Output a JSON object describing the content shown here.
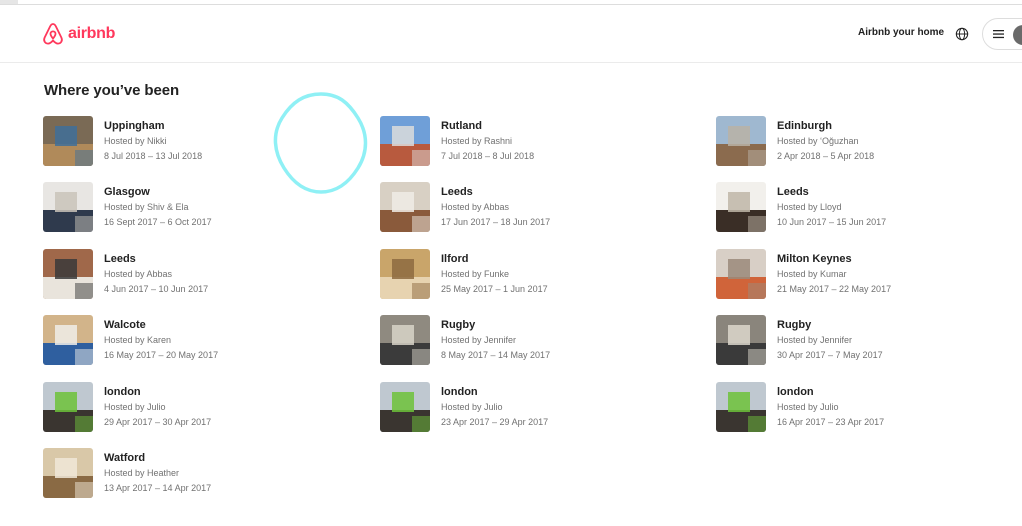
{
  "brand": {
    "name": "airbnb",
    "color": "#FF385C"
  },
  "header": {
    "host_link": "Airbnb your home",
    "globe_icon": "globe-icon",
    "menu_icon": "hamburger-menu-icon",
    "avatar_icon": "user-avatar-icon"
  },
  "page": {
    "title": "Where you’ve been"
  },
  "trips": [
    {
      "place": "Uppingham",
      "host": "Hosted by Nikki",
      "dates": "8 Jul 2018 – 13 Jul 2018",
      "thumb_colors": [
        "#7a6a55",
        "#b08a5a",
        "#3f6f9a"
      ]
    },
    {
      "place": "Rutland",
      "host": "Hosted by Rashni",
      "dates": "7 Jul 2018 – 8 Jul 2018",
      "thumb_colors": [
        "#6f9fd8",
        "#b85a3e",
        "#dcdcdc"
      ]
    },
    {
      "place": "Edinburgh",
      "host": "Hosted by ‘Oğuzhan",
      "dates": "2 Apr 2018 – 5 Apr 2018",
      "thumb_colors": [
        "#9fb8d0",
        "#8b6b4e",
        "#b9b2a6"
      ]
    },
    {
      "place": "Glasgow",
      "host": "Hosted by Shiv & Ela",
      "dates": "16 Sept 2017 – 6 Oct 2017",
      "thumb_colors": [
        "#e8e6e3",
        "#2f3a4d",
        "#c9c3ba"
      ]
    },
    {
      "place": "Leeds",
      "host": "Hosted by Abbas",
      "dates": "17 Jun 2017 – 18 Jun 2017",
      "thumb_colors": [
        "#d8d0c4",
        "#8a5a3b",
        "#f0ece6"
      ]
    },
    {
      "place": "Leeds",
      "host": "Hosted by Lloyd",
      "dates": "10 Jun 2017 – 15 Jun 2017",
      "thumb_colors": [
        "#f2f0ec",
        "#3a2e26",
        "#c0b6a8"
      ]
    },
    {
      "place": "Leeds",
      "host": "Hosted by Abbas",
      "dates": "4 Jun 2017 – 10 Jun 2017",
      "thumb_colors": [
        "#a0684a",
        "#e9e4dc",
        "#3a3a3a"
      ]
    },
    {
      "place": "Ilford",
      "host": "Hosted by Funke",
      "dates": "25 May 2017 – 1 Jun 2017",
      "thumb_colors": [
        "#c9a56a",
        "#e7d3b0",
        "#8d6a3f"
      ]
    },
    {
      "place": "Milton Keynes",
      "host": "Hosted by Kumar",
      "dates": "21 May 2017 – 22 May 2017",
      "thumb_colors": [
        "#d8cfc6",
        "#d0643a",
        "#9b8a7a"
      ]
    },
    {
      "place": "Walcote",
      "host": "Hosted by Karen",
      "dates": "16 May 2017 – 20 May 2017",
      "thumb_colors": [
        "#d2b48a",
        "#2f5f9f",
        "#f0ede8"
      ]
    },
    {
      "place": "Rugby",
      "host": "Hosted by Jennifer",
      "dates": "8 May 2017 – 14 May 2017",
      "thumb_colors": [
        "#8f8a80",
        "#3b3b3b",
        "#d8d3c8"
      ]
    },
    {
      "place": "Rugby",
      "host": "Hosted by Jennifer",
      "dates": "30 Apr 2017 – 7 May 2017",
      "thumb_colors": [
        "#8a857c",
        "#3a3a3a",
        "#dcd7cc"
      ]
    },
    {
      "place": "london",
      "host": "Hosted by Julio",
      "dates": "29 Apr 2017 – 30 Apr 2017",
      "thumb_colors": [
        "#bfc8d0",
        "#3a3530",
        "#6dc23a"
      ]
    },
    {
      "place": "london",
      "host": "Hosted by Julio",
      "dates": "23 Apr 2017 – 29 Apr 2017",
      "thumb_colors": [
        "#bfc8d0",
        "#3a3530",
        "#6dc23a"
      ]
    },
    {
      "place": "london",
      "host": "Hosted by Julio",
      "dates": "16 Apr 2017 – 23 Apr 2017",
      "thumb_colors": [
        "#bfc8d0",
        "#3a3530",
        "#6dc23a"
      ]
    },
    {
      "place": "Watford",
      "host": "Hosted by Heather",
      "dates": "13 Apr 2017 – 14 Apr 2017",
      "thumb_colors": [
        "#d9c8a8",
        "#8a6a44",
        "#f0e8d8"
      ]
    }
  ],
  "cursor_ring_color": "#8ff0f5"
}
